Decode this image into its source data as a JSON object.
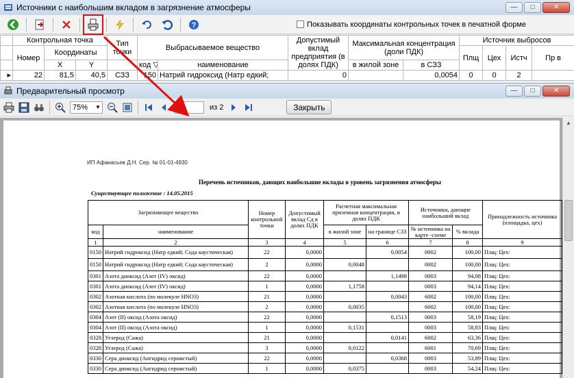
{
  "back_window": {
    "title": "Источники с наибольшим вкладом в загрязнение атмосферы",
    "checkbox_label": "Показывать координаты контрольных точек в печатной форме",
    "headers": {
      "control_point": "Контрольная точка",
      "number": "Номер",
      "coords": "Координаты",
      "x": "X",
      "y": "Y",
      "point_type": "Тип точки",
      "substance": "Выбрасываемое вещество",
      "code": "код",
      "name": "наименование",
      "allowed": "Допустимый вклад предприятия (в долях ПДК)",
      "max_conc": "Максимальная концентрация (доли ПДК)",
      "residential": "в жилой зоне",
      "sz": "в СЗЗ",
      "source": "Источник выбросов",
      "pl": "Плщ",
      "ceh": "Цех",
      "ist": "Истч",
      "pr": "Пр в"
    },
    "row": {
      "number": "22",
      "x": "81,5",
      "y": "40,5",
      "type": "СЗЗ",
      "code": "150",
      "name": "Натрий гидроксид (Натр едкий;",
      "allowed": "0",
      "residential": "",
      "sz": "0,0054",
      "pl": "0",
      "ceh": "0",
      "ist": "2"
    }
  },
  "preview_window": {
    "title": "Предварительный просмотр",
    "zoom": "75%",
    "page": "1",
    "of_pages": "из 2",
    "close_label": "Закрыть"
  },
  "document": {
    "author": "ИП Афанасьев Д.Н.   Сер. № 01-01-4930",
    "title": "Перечень источников, дающих наибольшие вклады в уровень загрязнения атмосферы",
    "subtitle": "Существующее положение : 14.05.2015",
    "headers": {
      "substance": "Загрязняющее вещество",
      "code": "код",
      "name": "наименование",
      "cp_number": "Номер контрольной точки",
      "allowed": "Допустимый вклад Сд в долях ПДК",
      "calc_max": "Расчетная максимальная приземная концентрация, в долях ПДК",
      "residential": "в жилой зоне",
      "sz_border": "на границе СЗЗ",
      "sources": "Источники, дающие наибольший вклад",
      "src_no": "№ источника на карте -схеме",
      "pct": "% вклада",
      "ownership": "Принадлежность источника (площадка, цех)"
    },
    "col_numbers": [
      "1",
      "2",
      "3",
      "4",
      "5",
      "6",
      "7",
      "8",
      "9"
    ],
    "rows": [
      {
        "code": "0150",
        "name": "Натрий гидроксид (Натр едкий; Сода каустическая)",
        "cp": "22",
        "allowed": "0,0000",
        "res": "",
        "sz": "0,0054",
        "src": "0002",
        "pct": "100,00",
        "own": "Плщ:   Цех:"
      },
      {
        "code": "0150",
        "name": "Натрий гидроксид (Натр едкий; Сода каустическая)",
        "cp": "2",
        "allowed": "0,0000",
        "res": "0,0048",
        "sz": "",
        "src": "0002",
        "pct": "100,00",
        "own": "Плщ:   Цех:"
      },
      {
        "code": "0301",
        "name": "Азота диоксид (Азот (IV) оксид)",
        "cp": "22",
        "allowed": "0,0000",
        "res": "",
        "sz": "1,1498",
        "src": "0003",
        "pct": "94,08",
        "own": "Плщ:   Цех:"
      },
      {
        "code": "0301",
        "name": "Азота диоксид (Азот (IV) оксид)",
        "cp": "1",
        "allowed": "0,0000",
        "res": "1,1758",
        "sz": "",
        "src": "0003",
        "pct": "94,14",
        "own": "Плщ:   Цех:"
      },
      {
        "code": "0302",
        "name": "Азотная кислота (по молекуле HNO3)",
        "cp": "21",
        "allowed": "0,0000",
        "res": "",
        "sz": "0,0043",
        "src": "6002",
        "pct": "100,00",
        "own": "Плщ:   Цех:"
      },
      {
        "code": "0302",
        "name": "Азотная кислота (по молекуле HNO3)",
        "cp": "2",
        "allowed": "0,0000",
        "res": "0,0035",
        "sz": "",
        "src": "6002",
        "pct": "100,00",
        "own": "Плщ:   Цех:"
      },
      {
        "code": "0304",
        "name": "Азот (II) оксид (Азота оксид)",
        "cp": "22",
        "allowed": "0,0000",
        "res": "",
        "sz": "0,1513",
        "src": "0003",
        "pct": "58,19",
        "own": "Плщ:   Цех:"
      },
      {
        "code": "0304",
        "name": "Азот (II) оксид (Азота оксид)",
        "cp": "1",
        "allowed": "0,0000",
        "res": "0,1531",
        "sz": "",
        "src": "0003",
        "pct": "58,83",
        "own": "Плщ:   Цех:"
      },
      {
        "code": "0328",
        "name": "Углерод (Сажа)",
        "cp": "21",
        "allowed": "0,0000",
        "res": "",
        "sz": "0,0141",
        "src": "6002",
        "pct": "63,36",
        "own": "Плщ:   Цех:"
      },
      {
        "code": "0328",
        "name": "Углерод (Сажа)",
        "cp": "3",
        "allowed": "0,0000",
        "res": "0,0122",
        "sz": "",
        "src": "6001",
        "pct": "70,69",
        "own": "Плщ:   Цех:"
      },
      {
        "code": "0330",
        "name": "Сера диоксид (Ангидрид сернистый)",
        "cp": "22",
        "allowed": "0,0000",
        "res": "",
        "sz": "0,0368",
        "src": "0003",
        "pct": "53,89",
        "own": "Плщ:   Цех:"
      },
      {
        "code": "0330",
        "name": "Сера диоксид (Ангидрид сернистый)",
        "cp": "1",
        "allowed": "0,0000",
        "res": "0,0375",
        "sz": "",
        "src": "0003",
        "pct": "54,24",
        "own": "Плщ:   Цех:"
      }
    ]
  },
  "colors": {
    "annotation": "#e01010",
    "titlebar_top": "#dde8f5",
    "titlebar_bottom": "#c8d8ec",
    "workspace": "#aaaaaa"
  }
}
